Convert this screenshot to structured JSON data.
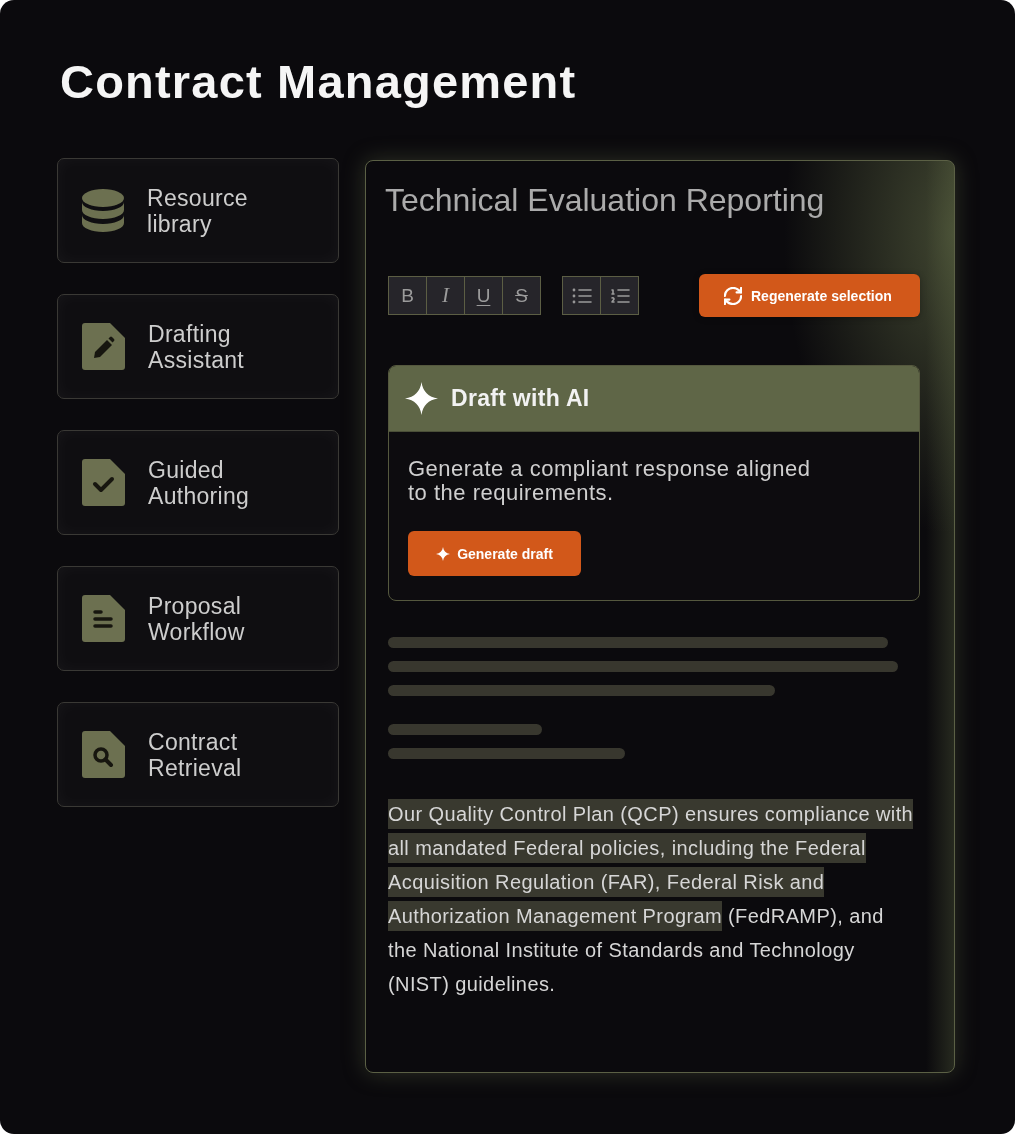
{
  "title": "Contract Management",
  "sidebar": {
    "items": [
      {
        "kind": "database",
        "label": "Resource library"
      },
      {
        "kind": "edit",
        "label": "Drafting Assistant"
      },
      {
        "kind": "check",
        "label": "Guided Authoring"
      },
      {
        "kind": "lines",
        "label": "Proposal Workflow"
      },
      {
        "kind": "search",
        "label": "Contract Retrieval"
      }
    ]
  },
  "editor": {
    "title": "Technical Evaluation Reporting",
    "format_buttons": [
      {
        "kind": "bold",
        "label": "B"
      },
      {
        "kind": "italic",
        "label": "I"
      },
      {
        "kind": "underline",
        "label": "U"
      },
      {
        "kind": "strikethrough",
        "label": "S"
      }
    ],
    "regenerate_button": {
      "label": "Regenerate selection"
    },
    "draft_card": {
      "title": "Draft with AI",
      "description": "Generate a compliant response aligned to the requirements.",
      "button": {
        "label": "Generate draft"
      }
    },
    "paragraph": {
      "selected_text": "Our Quality Control Plan (QCP) ensures compliance with all mandated Federal policies, including the Federal Acquisition Regulation (FAR), Federal Risk and Authorization Management Program",
      "text": "(FedRAMP), and the National Institute of Standards and Technology (NIST) guidelines."
    }
  }
}
